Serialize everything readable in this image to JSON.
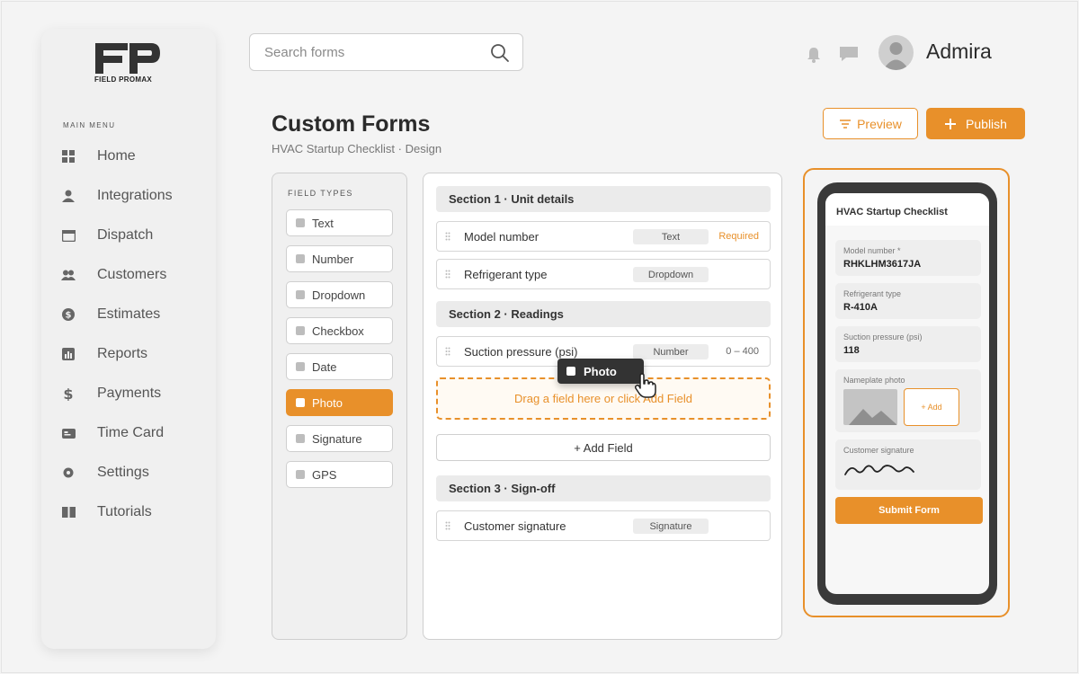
{
  "brand": {
    "name": "FIELD PROMAX",
    "logo_letters": "FP",
    "accent": "#e8902a"
  },
  "sidebar": {
    "menu_title": "MAIN MENU",
    "items": [
      {
        "label": "Home",
        "icon": "grid-icon"
      },
      {
        "label": "Integrations",
        "icon": "user-icon"
      },
      {
        "label": "Dispatch",
        "icon": "calendar-icon"
      },
      {
        "label": "Customers",
        "icon": "users-icon"
      },
      {
        "label": "Estimates",
        "icon": "dollar-circle-icon"
      },
      {
        "label": "Reports",
        "icon": "bar-chart-icon"
      },
      {
        "label": "Payments",
        "icon": "dollar-icon"
      },
      {
        "label": "Time Card",
        "icon": "id-card-icon"
      },
      {
        "label": "Settings",
        "icon": "gear-icon"
      },
      {
        "label": "Tutorials",
        "icon": "book-icon"
      }
    ]
  },
  "topbar": {
    "search_placeholder": "Search forms",
    "user_name": "Admira"
  },
  "header": {
    "title": "Custom Forms",
    "subtitle": "HVAC Startup Checklist · Design",
    "preview_label": "Preview",
    "publish_label": "Publish"
  },
  "field_types": {
    "title": "FIELD TYPES",
    "items": [
      "Text",
      "Number",
      "Dropdown",
      "Checkbox",
      "Date",
      "Photo",
      "Signature",
      "GPS"
    ],
    "active": "Photo"
  },
  "builder": {
    "sections": [
      {
        "title": "Section 1 · Unit details",
        "fields": [
          {
            "name": "Model number",
            "type": "Text",
            "extra": "Required"
          },
          {
            "name": "Refrigerant type",
            "type": "Dropdown",
            "extra": ""
          }
        ]
      },
      {
        "title": "Section 2 · Readings",
        "fields": [
          {
            "name": "Suction pressure (psi)",
            "type": "Number",
            "extra": "0 – 400"
          }
        ]
      },
      {
        "title": "Section 3 · Sign-off",
        "fields": [
          {
            "name": "Customer signature",
            "type": "Signature",
            "extra": ""
          }
        ]
      }
    ],
    "drop_zone_text": "Drag a field here or click Add Field",
    "add_field_label": "+ Add Field",
    "dragging_label": "Photo"
  },
  "preview": {
    "form_title": "HVAC Startup Checklist",
    "fields": [
      {
        "label": "Model number *",
        "value": "RHKLHM3617JA"
      },
      {
        "label": "Refrigerant type",
        "value": "R-410A"
      },
      {
        "label": "Suction pressure (psi)",
        "value": "118"
      }
    ],
    "photo_label": "Nameplate photo",
    "photo_add_label": "+ Add",
    "signature_label": "Customer signature",
    "submit_label": "Submit Form"
  }
}
